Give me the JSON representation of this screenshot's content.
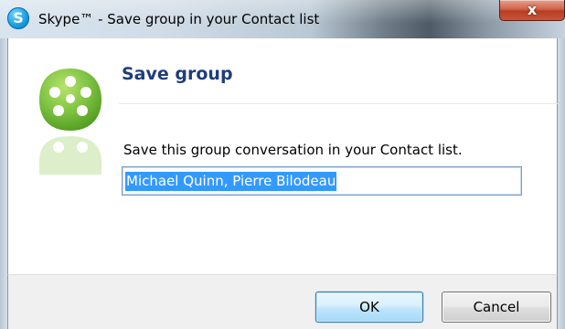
{
  "window": {
    "app_icon_glyph": "S",
    "title": "Skype™ - Save group in your Contact list",
    "close_glyph": "x"
  },
  "dialog": {
    "heading": "Save group",
    "instruction": "Save this group conversation in your Contact list.",
    "group_name_value": "Michael Quinn, Pierre Bilodeau",
    "logo_icon": "skype-group-logo-icon"
  },
  "buttons": {
    "ok_label": "OK",
    "cancel_label": "Cancel"
  },
  "colors": {
    "heading": "#1e3d78",
    "logo_green": "#7dc242",
    "selection": "#3399ff"
  }
}
